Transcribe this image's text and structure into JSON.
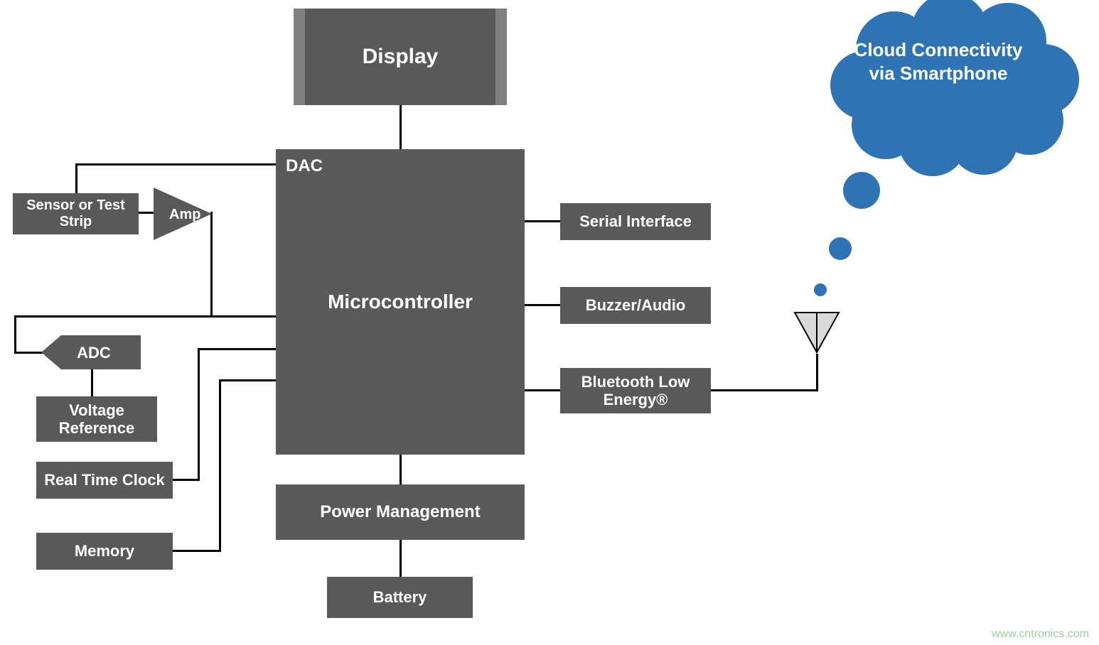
{
  "diagram": {
    "display": "Display",
    "mcu": {
      "dac": "DAC",
      "title": "Microcontroller"
    },
    "sensor": "Sensor or Test Strip",
    "amp": "Amp",
    "adc": "ADC",
    "voltage_reference": "Voltage Reference",
    "rtc": "Real Time Clock",
    "memory": "Memory",
    "power_management": "Power Management",
    "battery": "Battery",
    "serial_interface": "Serial Interface",
    "buzzer_audio": "Buzzer/Audio",
    "ble": "Bluetooth Low Energy®",
    "cloud": "Cloud Connectivity via Smartphone"
  },
  "watermark": "www.cntronics.com",
  "colors": {
    "block": "#595959",
    "display_border": "#808080",
    "cloud": "#2E74B5",
    "antenna_fill": "#D9D9D9"
  }
}
